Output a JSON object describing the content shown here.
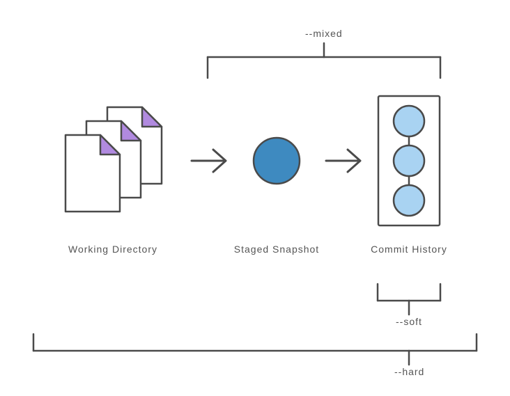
{
  "labels": {
    "working_directory": "Working Directory",
    "staged_snapshot": "Staged Snapshot",
    "commit_history": "Commit History"
  },
  "flags": {
    "mixed": "--mixed",
    "soft": "--soft",
    "hard": "--hard"
  },
  "colors": {
    "stroke": "#4a4a4a",
    "file_fold": "#b18ae0",
    "staged_fill": "#3e8ac0",
    "commit_fill": "#a9d3f2"
  }
}
